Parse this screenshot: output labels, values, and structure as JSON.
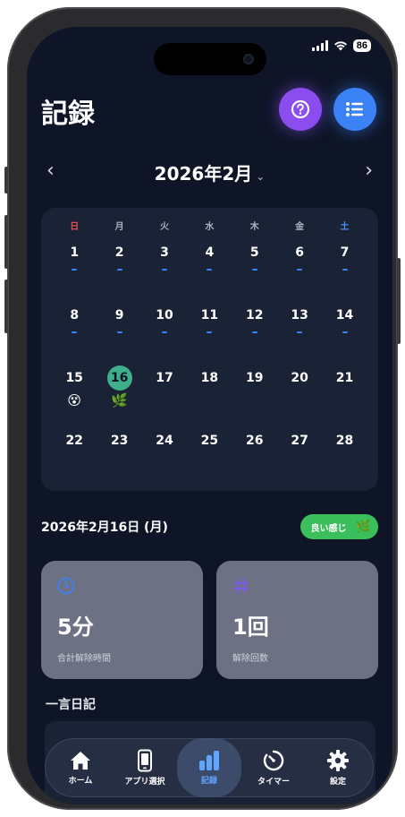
{
  "status_bar": {
    "battery": "86"
  },
  "header": {
    "title": "記録",
    "help_icon": "question-circle-icon",
    "list_icon": "list-icon"
  },
  "month_nav": {
    "label": "2026年2月",
    "prev": "‹",
    "next": "›",
    "chevron": "⌄"
  },
  "calendar": {
    "weekdays": [
      "日",
      "月",
      "火",
      "水",
      "木",
      "金",
      "土"
    ],
    "weekday_colors": {
      "sunday": "#e05252",
      "saturday": "#4f8ef7",
      "default": "#aab2c2"
    },
    "weeks": [
      [
        {
          "d": "1",
          "dash": true
        },
        {
          "d": "2",
          "dash": true
        },
        {
          "d": "3",
          "dash": true
        },
        {
          "d": "4",
          "dash": true
        },
        {
          "d": "5",
          "dash": true
        },
        {
          "d": "6",
          "dash": true
        },
        {
          "d": "7",
          "dash": true
        }
      ],
      [
        {
          "d": "8",
          "dash": true
        },
        {
          "d": "9",
          "dash": true
        },
        {
          "d": "10",
          "dash": true
        },
        {
          "d": "11",
          "dash": true
        },
        {
          "d": "12",
          "dash": true
        },
        {
          "d": "13",
          "dash": true
        },
        {
          "d": "14",
          "dash": true
        }
      ],
      [
        {
          "d": "15",
          "mood": "😵"
        },
        {
          "d": "16",
          "mood": "🌿",
          "today": true
        },
        {
          "d": "17"
        },
        {
          "d": "18"
        },
        {
          "d": "19"
        },
        {
          "d": "20"
        },
        {
          "d": "21"
        }
      ],
      [
        {
          "d": "22"
        },
        {
          "d": "23"
        },
        {
          "d": "24"
        },
        {
          "d": "25"
        },
        {
          "d": "26"
        },
        {
          "d": "27"
        },
        {
          "d": "28"
        }
      ]
    ]
  },
  "selected_day": {
    "date": "2026年2月16日 (月)",
    "mood_label": "良い感じ",
    "mood_icon": "🌿"
  },
  "stats": [
    {
      "value": "5分",
      "label": "合計解除時間",
      "icon": "clock-icon",
      "color": "#3b82f6"
    },
    {
      "value": "1回",
      "label": "解除回数",
      "icon": "hash-icon",
      "color": "#7c5cf0"
    }
  ],
  "diary": {
    "title": "一言日記"
  },
  "tabbar": {
    "items": [
      {
        "label": "ホーム",
        "icon": "home-icon"
      },
      {
        "label": "アプリ選択",
        "icon": "phone-icon"
      },
      {
        "label": "記録",
        "icon": "bar-chart-icon",
        "active": true
      },
      {
        "label": "タイマー",
        "icon": "timer-icon"
      },
      {
        "label": "設定",
        "icon": "gear-icon"
      }
    ],
    "active_color": "#5fa6ff"
  }
}
